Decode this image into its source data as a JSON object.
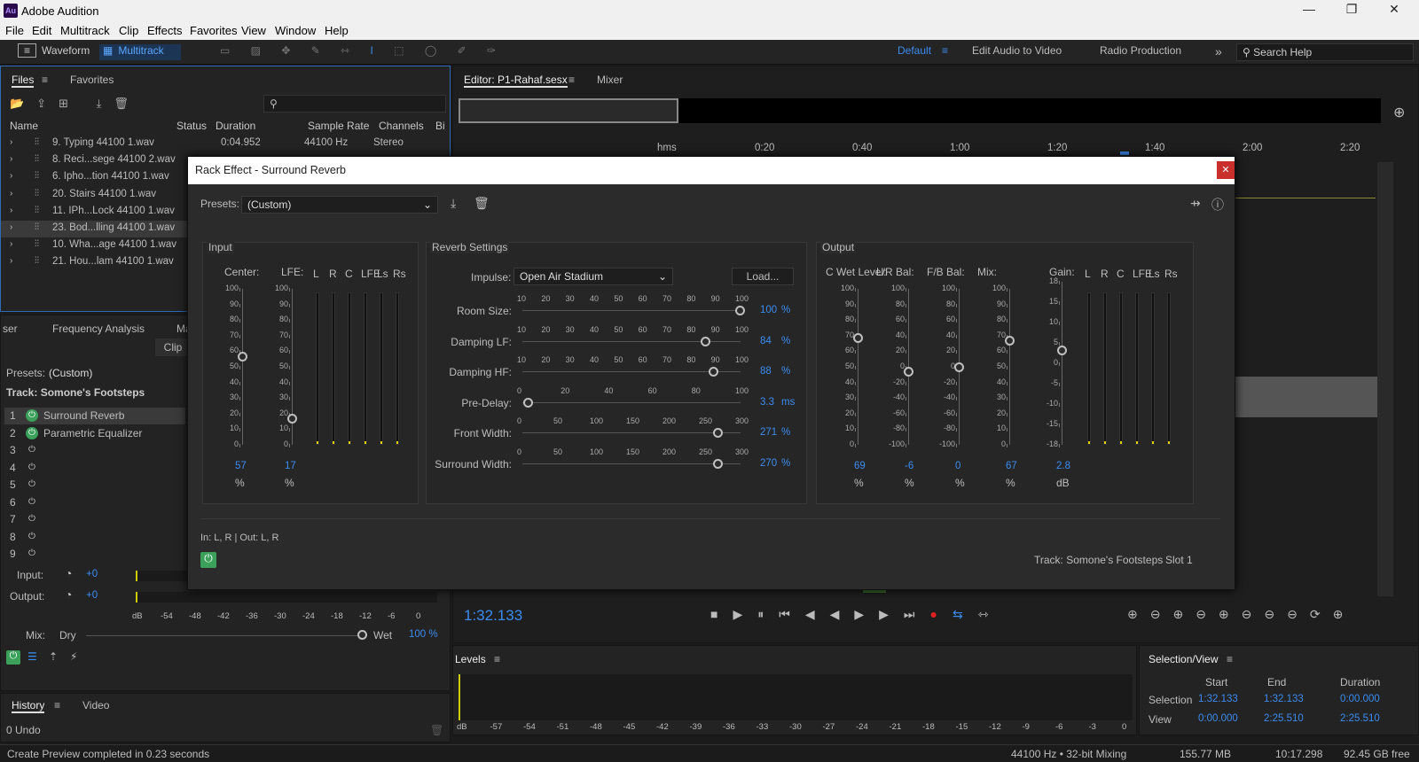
{
  "app": {
    "title": "Adobe Audition",
    "logo": "Au"
  },
  "menu": [
    "File",
    "Edit",
    "Multitrack",
    "Clip",
    "Effects",
    "Favorites",
    "View",
    "Window",
    "Help"
  ],
  "toolbar": {
    "waveform": "Waveform",
    "multitrack": "Multitrack",
    "workspaces": [
      "Default",
      "Edit Audio to Video",
      "Radio Production"
    ],
    "search_placeholder": "Search Help"
  },
  "files_panel": {
    "tabs": [
      "Files",
      "Favorites"
    ],
    "columns": [
      "Name",
      "Status",
      "Duration",
      "Sample Rate",
      "Channels",
      "Bi"
    ],
    "rows": [
      {
        "name": "9. Typing 44100 1.wav",
        "duration": "0:04.952",
        "rate": "44100 Hz",
        "channels": "Stereo"
      },
      {
        "name": "8. Reci...sege 44100 2.wav",
        "duration": "",
        "rate": "",
        "channels": ""
      },
      {
        "name": "6. Ipho...tion 44100 1.wav",
        "duration": "",
        "rate": "",
        "channels": ""
      },
      {
        "name": "20. Stairs 44100 1.wav",
        "duration": "",
        "rate": "",
        "channels": ""
      },
      {
        "name": "11. IPh...Lock 44100 1.wav",
        "duration": "",
        "rate": "",
        "channels": ""
      },
      {
        "name": "23. Bod...lling 44100 1.wav",
        "duration": "",
        "rate": "",
        "channels": ""
      },
      {
        "name": "10. Wha...age 44100 1.wav",
        "duration": "",
        "rate": "",
        "channels": ""
      },
      {
        "name": "21. Hou...lam 44100 1.wav",
        "duration": "",
        "rate": "",
        "channels": ""
      }
    ]
  },
  "effects_rack": {
    "tabs": [
      "ser",
      "Frequency Analysis",
      "Ma"
    ],
    "clip_btn": "Clip",
    "presets_label": "Presets:",
    "presets_value": "(Custom)",
    "track_label": "Track: Somone's Footsteps",
    "slots": [
      {
        "n": "1",
        "name": "Surround Reverb"
      },
      {
        "n": "2",
        "name": "Parametric Equalizer"
      },
      {
        "n": "3",
        "name": ""
      },
      {
        "n": "4",
        "name": ""
      },
      {
        "n": "5",
        "name": ""
      },
      {
        "n": "6",
        "name": ""
      },
      {
        "n": "7",
        "name": ""
      },
      {
        "n": "8",
        "name": ""
      },
      {
        "n": "9",
        "name": ""
      }
    ],
    "input_label": "Input:",
    "input_val": "+0",
    "output_label": "Output:",
    "output_val": "+0",
    "db_scale": [
      "dB",
      "-54",
      "-48",
      "-42",
      "-36",
      "-30",
      "-24",
      "-18",
      "-12",
      "-6",
      "0"
    ],
    "mix_label": "Mix:",
    "dry": "Dry",
    "wet": "Wet",
    "mix_val": "100 %"
  },
  "history": {
    "tabs": [
      "History",
      "Video"
    ],
    "undo": "0 Undo"
  },
  "editor": {
    "tab": "Editor: P1-Rahaf.sesx",
    "mixer": "Mixer",
    "ruler": [
      "hms",
      "0:20",
      "0:40",
      "1:00",
      "1:20",
      "1:40",
      "2:00",
      "2:20"
    ],
    "time": "1:32.133"
  },
  "levels": {
    "title": "Levels",
    "scale": [
      "dB",
      "-57",
      "-54",
      "-51",
      "-48",
      "-45",
      "-42",
      "-39",
      "-36",
      "-33",
      "-30",
      "-27",
      "-24",
      "-21",
      "-18",
      "-15",
      "-12",
      "-9",
      "-6",
      "-3",
      "0"
    ]
  },
  "selection": {
    "title": "Selection/View",
    "cols": [
      "Start",
      "End",
      "Duration"
    ],
    "selection_row": {
      "label": "Selection",
      "start": "1:32.133",
      "end": "1:32.133",
      "duration": "0:00.000"
    },
    "view_row": {
      "label": "View",
      "start": "0:00.000",
      "end": "2:25.510",
      "duration": "2:25.510"
    }
  },
  "status": {
    "left": "Create Preview completed in 0.23 seconds",
    "mix": "44100 Hz • 32-bit Mixing",
    "mem": "155.77 MB",
    "dur": "10:17.298",
    "free": "92.45 GB free"
  },
  "dialog": {
    "title": "Rack Effect - Surround Reverb",
    "presets_label": "Presets:",
    "presets_value": "(Custom)",
    "input_group": "Input",
    "reverb_group": "Reverb Settings",
    "output_group": "Output",
    "center_label": "Center:",
    "lfe_label": "LFE:",
    "center_val": "57",
    "lfe_val": "17",
    "pct": "%",
    "channels": [
      "L",
      "R",
      "C",
      "LFE",
      "Ls",
      "Rs"
    ],
    "vscale": [
      "100",
      "90",
      "80",
      "70",
      "60",
      "50",
      "40",
      "30",
      "20",
      "10",
      "0"
    ],
    "impulse_label": "Impulse:",
    "impulse_value": "Open Air Stadium",
    "load": "Load...",
    "params": [
      {
        "label": "Room Size:",
        "value": "100",
        "unit": "%",
        "scale": [
          "10",
          "20",
          "30",
          "40",
          "50",
          "60",
          "70",
          "80",
          "90",
          "100"
        ],
        "level": 1.0
      },
      {
        "label": "Damping LF:",
        "value": "84",
        "unit": "%",
        "scale": [
          "10",
          "20",
          "30",
          "40",
          "50",
          "60",
          "70",
          "80",
          "90",
          "100"
        ],
        "level": 0.84
      },
      {
        "label": "Damping HF:",
        "value": "88",
        "unit": "%",
        "scale": [
          "10",
          "20",
          "30",
          "40",
          "50",
          "60",
          "70",
          "80",
          "90",
          "100"
        ],
        "level": 0.88
      },
      {
        "label": "Pre-Delay:",
        "value": "3.3",
        "unit": "ms",
        "scale": [
          "0",
          "20",
          "40",
          "60",
          "80",
          "100"
        ],
        "level": 0.03
      },
      {
        "label": "Front Width:",
        "value": "271",
        "unit": "%",
        "scale": [
          "0",
          "50",
          "100",
          "150",
          "200",
          "250",
          "300"
        ],
        "level": 0.9
      },
      {
        "label": "Surround Width:",
        "value": "270",
        "unit": "%",
        "scale": [
          "0",
          "50",
          "100",
          "150",
          "200",
          "250",
          "300"
        ],
        "level": 0.9
      }
    ],
    "out_knobs": [
      {
        "label": "C Wet Level:",
        "value": "69",
        "unit": "%",
        "scale": [
          "100",
          "90",
          "80",
          "70",
          "60",
          "50",
          "40",
          "30",
          "20",
          "10",
          "0"
        ],
        "level": 0.69
      },
      {
        "label": "L/R Bal:",
        "value": "-6",
        "unit": "%",
        "scale": [
          "100",
          "80",
          "60",
          "40",
          "20",
          "0",
          "-20",
          "-40",
          "-60",
          "-80",
          "-100"
        ],
        "level": 0.47
      },
      {
        "label": "F/B Bal:",
        "value": "0",
        "unit": "%",
        "scale": [
          "100",
          "80",
          "60",
          "40",
          "20",
          "0",
          "-20",
          "-40",
          "-60",
          "-80",
          "-100"
        ],
        "level": 0.5
      },
      {
        "label": "Mix:",
        "value": "67",
        "unit": "%",
        "scale": [
          "100",
          "90",
          "80",
          "70",
          "60",
          "50",
          "40",
          "30",
          "20",
          "10",
          "0"
        ],
        "level": 0.67
      }
    ],
    "gain": {
      "label": "Gain:",
      "value": "2.8",
      "unit": "dB",
      "scale": [
        "18",
        "15",
        "10",
        "5",
        "0",
        "-5",
        "-10",
        "-15",
        "-18"
      ],
      "level": 0.58
    },
    "io": "In: L, R | Out: L, R",
    "track": "Track: Somone's Footsteps",
    "slot": "Slot 1"
  }
}
